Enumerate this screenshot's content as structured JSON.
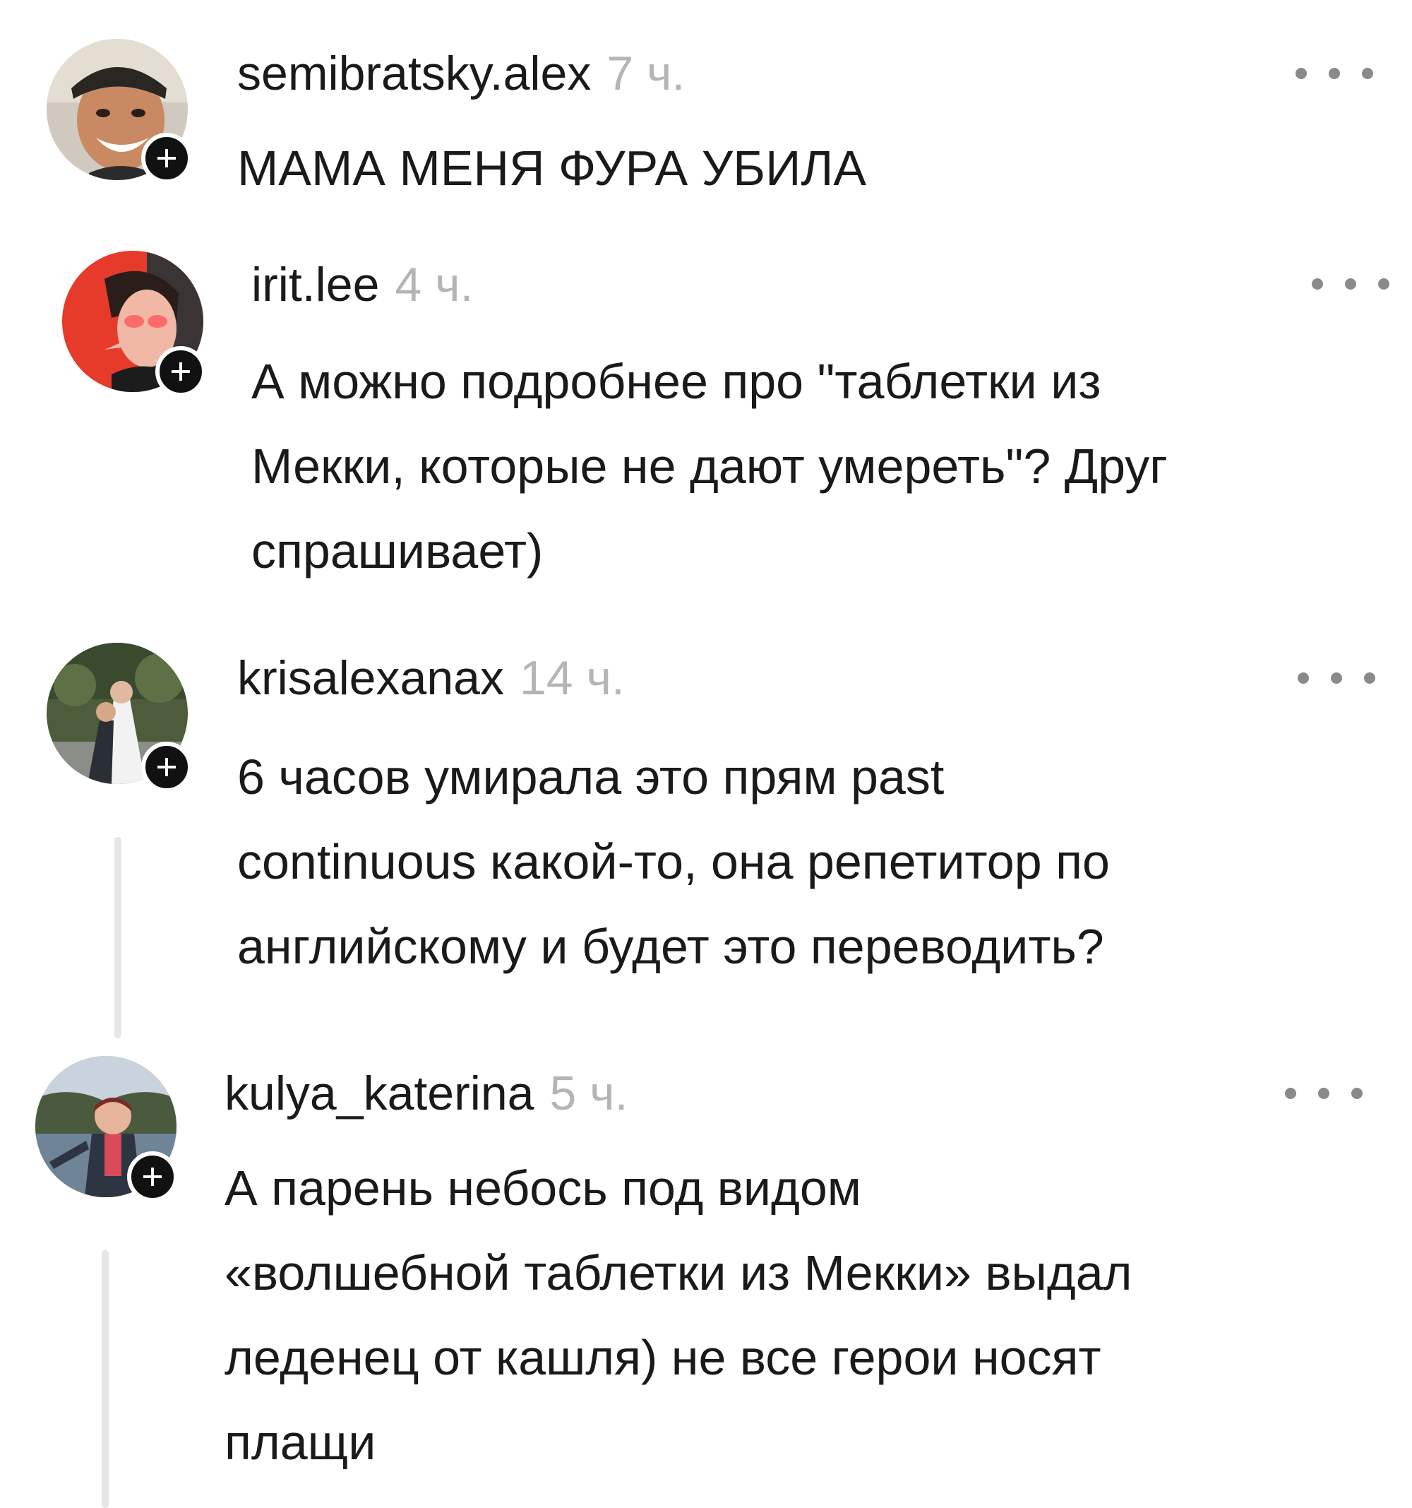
{
  "comments": [
    {
      "username": "semibratsky.alex",
      "time": "7 ч.",
      "text_lines": [
        "МАМА МЕНЯ ФУРА УБИЛА"
      ],
      "avatar_icon": "user-photo-man-smiling"
    },
    {
      "username": "irit.lee",
      "time": "4 ч.",
      "text_lines": [
        "А можно подробнее про \"таблетки из",
        "Мекки, которые не дают умереть\"? Друг",
        "спрашивает)"
      ],
      "avatar_icon": "user-photo-illustration-red"
    },
    {
      "username": "krisalexanax",
      "time": "14 ч.",
      "text_lines": [
        "6 часов умирала это прям past",
        "continuous какой-то, она репетитор по",
        "английскому и будет это переводить?"
      ],
      "avatar_icon": "user-photo-wedding-couple"
    },
    {
      "username": "kulya_katerina",
      "time": "5 ч.",
      "text_lines": [
        "А парень небось под видом",
        "«волшебной таблетки из Мекки» выдал",
        "леденец от кашля) не все герои носят",
        "плащи"
      ],
      "avatar_icon": "user-photo-woman-lake"
    }
  ],
  "icons": {
    "follow": "plus-icon",
    "more": "more-horizontal-icon"
  },
  "colors": {
    "text": "#1a1a1a",
    "timestamp": "#b5b5b5",
    "badge": "#111111",
    "dots": "#8a8a8a",
    "thread_line": "#e6e6e6"
  }
}
